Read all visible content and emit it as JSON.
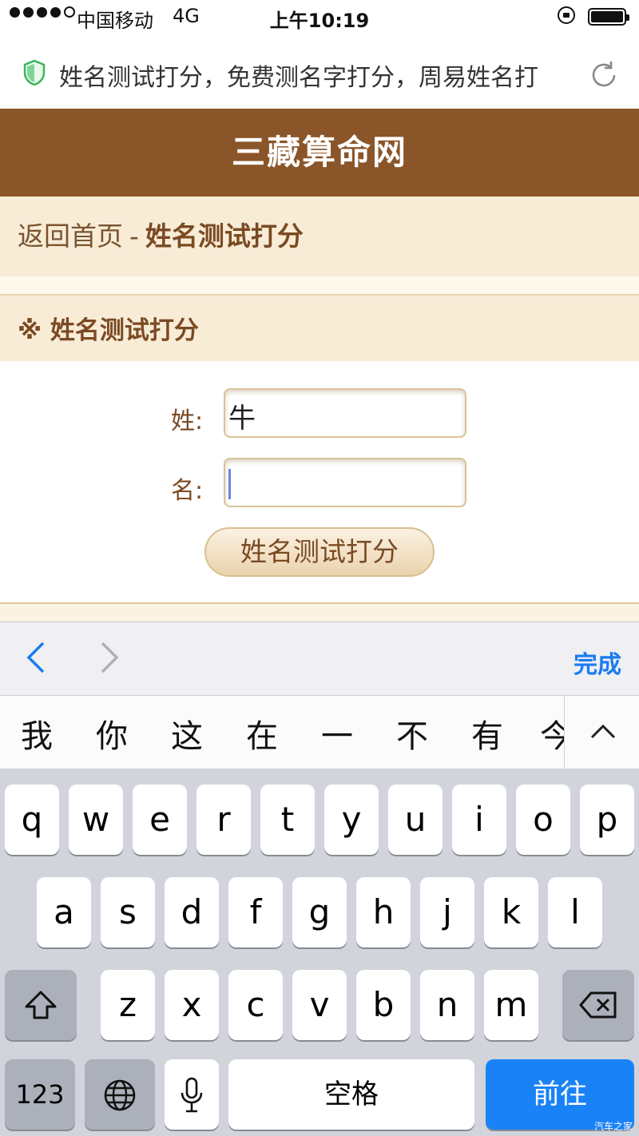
{
  "status_bar": {
    "carrier": "中国移动",
    "network": "4G",
    "time": "上午10:19"
  },
  "browser": {
    "url_text": "姓名测试打分，免费测名字打分，周易姓名打"
  },
  "site": {
    "title": "三藏算命网"
  },
  "breadcrumb": {
    "home": "返回首页",
    "separator": "-",
    "current": "姓名测试打分"
  },
  "section": {
    "title": "※ 姓名测试打分"
  },
  "form": {
    "surname_label": "姓:",
    "surname_value": "牛",
    "given_label": "名:",
    "given_value": "",
    "submit_label": "姓名测试打分"
  },
  "accessory": {
    "done_label": "完成"
  },
  "candidates": [
    "我",
    "你",
    "这",
    "在",
    "一",
    "不",
    "有",
    "今"
  ],
  "keyboard": {
    "row1": [
      "q",
      "w",
      "e",
      "r",
      "t",
      "y",
      "u",
      "i",
      "o",
      "p"
    ],
    "row2": [
      "a",
      "s",
      "d",
      "f",
      "g",
      "h",
      "j",
      "k",
      "l"
    ],
    "row3": [
      "z",
      "x",
      "c",
      "v",
      "b",
      "n",
      "m"
    ],
    "numbers_label": "123",
    "space_label": "空格",
    "go_label": "前往"
  },
  "watermark": "汽车之家",
  "colors": {
    "header": "#8a5528",
    "accent_blue": "#1a82f7",
    "breadcrumb_bg": "#f8ecd6"
  }
}
